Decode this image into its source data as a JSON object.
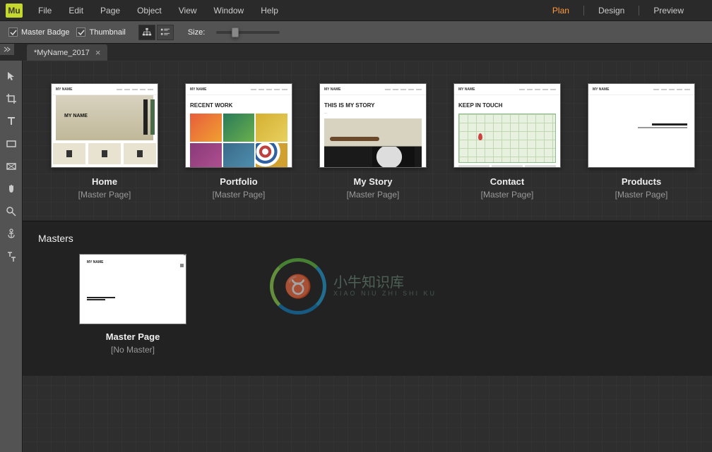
{
  "app": {
    "logo_text": "Mu"
  },
  "menu": {
    "items": [
      "File",
      "Edit",
      "Page",
      "Object",
      "View",
      "Window",
      "Help"
    ]
  },
  "modes": {
    "items": [
      "Plan",
      "Design",
      "Preview"
    ],
    "active_index": 0
  },
  "toolbar": {
    "master_badge_label": "Master Badge",
    "master_badge_checked": true,
    "thumbnail_label": "Thumbnail",
    "thumbnail_checked": true,
    "size_label": "Size:"
  },
  "document": {
    "tab_name": "*MyName_2017"
  },
  "tools": [
    "selection-tool",
    "crop-tool",
    "text-tool",
    "rectangle-tool",
    "rectangle-frame-tool",
    "hand-tool",
    "zoom-tool",
    "anchor-tool",
    "vertical-text-tool"
  ],
  "pages": [
    {
      "title": "Home",
      "master": "[Master Page]",
      "hero_label": "MY NAME",
      "header_brand": "MY NAME"
    },
    {
      "title": "Portfolio",
      "master": "[Master Page]",
      "hero_label": "RECENT WORK",
      "header_brand": "MY NAME"
    },
    {
      "title": "My Story",
      "master": "[Master Page]",
      "hero_label": "THIS IS MY STORY",
      "header_brand": "MY NAME"
    },
    {
      "title": "Contact",
      "master": "[Master Page]",
      "hero_label": "KEEP IN TOUCH",
      "header_brand": "MY NAME"
    },
    {
      "title": "Products",
      "master": "[Master Page]",
      "hero_label": "",
      "header_brand": "MY NAME"
    }
  ],
  "masters_section": {
    "heading": "Masters",
    "items": [
      {
        "title": "Master Page",
        "master": "[No Master]",
        "brand": "MY NAME"
      }
    ]
  },
  "watermark": {
    "text_main": "小牛知识库",
    "text_sub": "XIAO NIU ZHI SHI KU"
  }
}
